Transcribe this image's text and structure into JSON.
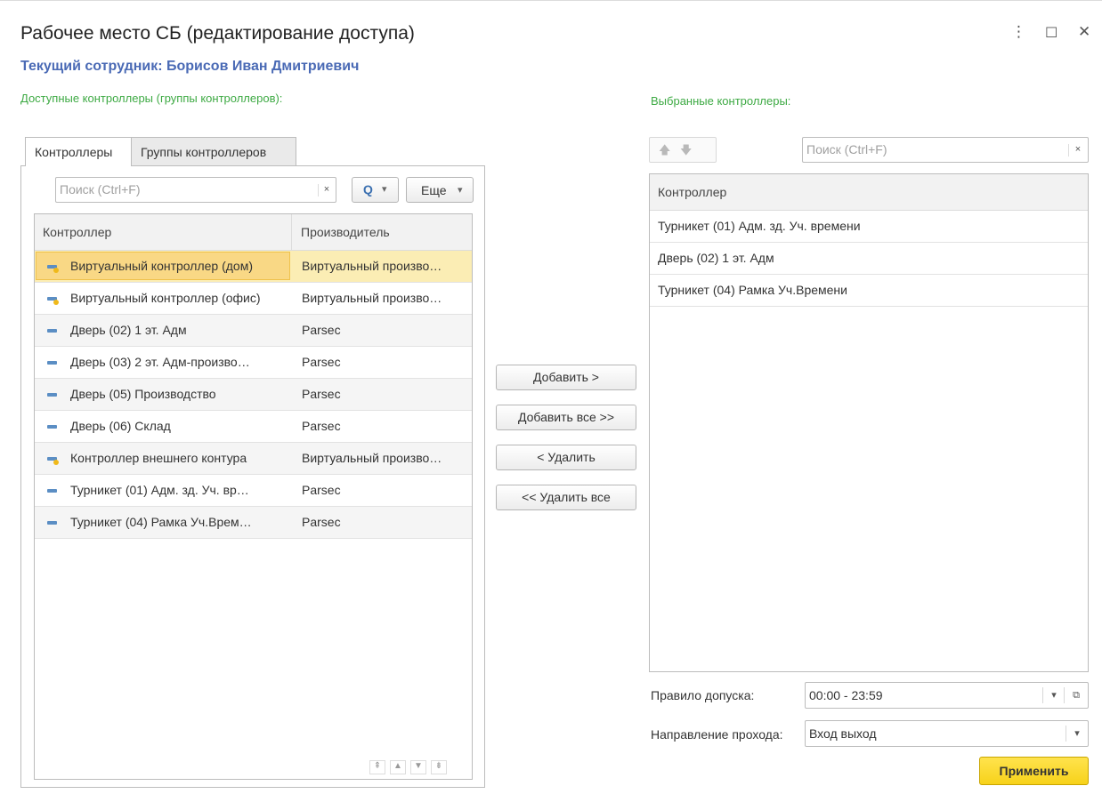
{
  "window": {
    "title": "Рабочее место СБ (редактирование доступа)",
    "menu_icon": "⋮",
    "maximize_icon": "☐",
    "close_icon": "✕"
  },
  "employee_label": "Текущий сотрудник: Борисов Иван Дмитриевич",
  "left": {
    "caption": "Доступные контроллеры (группы контроллеров):",
    "tabs": [
      {
        "label": "Контроллеры",
        "active": true
      },
      {
        "label": "Группы контроллеров",
        "active": false
      }
    ],
    "search": {
      "placeholder": "Поиск (Ctrl+F)",
      "clear": "×",
      "find": "Q",
      "find_dropdown": "▾",
      "more": "Еще",
      "more_dropdown": "▾"
    },
    "columns": [
      "Контроллер",
      "Производитель"
    ],
    "rows": [
      {
        "name": "Виртуальный контроллер (дом)",
        "maker": "Виртуальный произво…",
        "type": "virtual",
        "selected": true
      },
      {
        "name": "Виртуальный контроллер (офис)",
        "maker": "Виртуальный произво…",
        "type": "virtual",
        "selected": false
      },
      {
        "name": "Дверь (02) 1 эт. Адм",
        "maker": "Parsec",
        "type": "real",
        "selected": false
      },
      {
        "name": "Дверь (03) 2 эт. Адм-произво…",
        "maker": "Parsec",
        "type": "real",
        "selected": false
      },
      {
        "name": "Дверь (05) Производство",
        "maker": "Parsec",
        "type": "real",
        "selected": false
      },
      {
        "name": "Дверь (06) Склад",
        "maker": "Parsec",
        "type": "real",
        "selected": false
      },
      {
        "name": "Контроллер внешнего контура",
        "maker": "Виртуальный произво…",
        "type": "virtual",
        "selected": false
      },
      {
        "name": "Турникет (01) Адм. зд. Уч. вр…",
        "maker": "Parsec",
        "type": "real",
        "selected": false
      },
      {
        "name": "Турникет (04) Рамка Уч.Врем…",
        "maker": "Parsec",
        "type": "real",
        "selected": false
      }
    ],
    "nav": [
      "⇞",
      "▲",
      "▼",
      "⇟"
    ]
  },
  "middle": {
    "add": "Добавить >",
    "add_all": "Добавить все >>",
    "remove": "< Удалить",
    "remove_all": "<< Удалить все"
  },
  "right": {
    "caption": "Выбранные контроллеры:",
    "up_icon": "🡅",
    "down_icon": "🡇",
    "search": {
      "placeholder": "Поиск (Ctrl+F)",
      "clear": "×"
    },
    "column": "Контроллер",
    "rows": [
      "Турникет (01) Адм. зд. Уч. времени",
      "Дверь (02) 1 эт. Адм",
      "Турникет (04) Рамка Уч.Времени"
    ],
    "rule_label": "Правило допуска:",
    "rule_value": "00:00 - 23:59",
    "rule_dropdown": "▾",
    "rule_open": "⧉",
    "direction_label": "Направление прохода:",
    "direction_value": "Вход выход",
    "direction_dropdown": "▾",
    "apply": "Применить"
  },
  "colors": {
    "accent_blue": "#4a6ab5",
    "caption_green": "#3eaa44",
    "apply_yellow": "#f7d21a",
    "selection": "#f9d885"
  }
}
